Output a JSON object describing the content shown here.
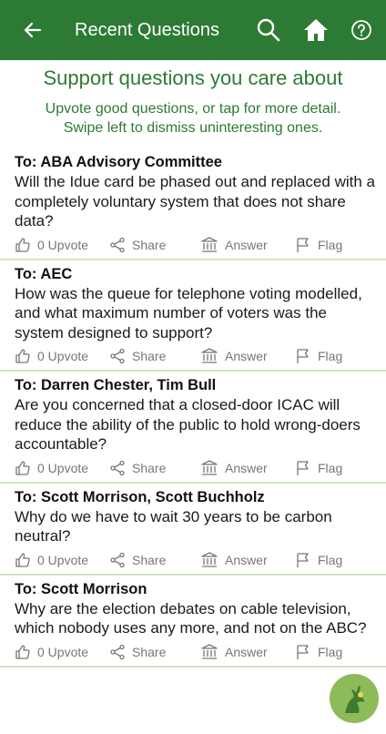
{
  "app_bar": {
    "title": "Recent Questions",
    "icons": [
      "back-arrow-icon",
      "search-icon",
      "home-icon",
      "help-icon"
    ]
  },
  "intro": {
    "heading": "Support questions you care about",
    "line1": "Upvote good questions, or tap for more detail.",
    "line2": "Swipe left to dismiss uninteresting ones."
  },
  "questions": [
    {
      "to": "To: ABA Advisory Committee",
      "text": "Will the Idue card be phased out and replaced with a completely voluntary system that does not share data?",
      "upvote": "0 Upvote",
      "share": "Share",
      "answer": "Answer",
      "flag": "Flag"
    },
    {
      "to": "To: AEC",
      "text": "How was the queue for telephone voting modelled, and what maximum number of voters was the system designed to support?",
      "upvote": "0 Upvote",
      "share": "Share",
      "answer": "Answer",
      "flag": "Flag"
    },
    {
      "to": "To: Darren Chester, Tim Bull",
      "text": "Are you concerned that a closed-door ICAC will reduce the ability of the public to hold wrong-doers accountable?",
      "upvote": "0 Upvote",
      "share": "Share",
      "answer": "Answer",
      "flag": "Flag"
    },
    {
      "to": "To: Scott Morrison, Scott Buchholz",
      "text": "Why do we have to wait 30 years to be carbon neutral?",
      "upvote": "0 Upvote",
      "share": "Share",
      "answer": "Answer",
      "flag": "Flag"
    },
    {
      "to": "To: Scott Morrison",
      "text": "Why are the election debates on cable television, which nobody uses any more, and not on the ABC?",
      "upvote": "0 Upvote",
      "share": "Share",
      "answer": "Answer",
      "flag": "Flag"
    }
  ],
  "colors": {
    "primary": "#2d7a34",
    "divider": "#cfe4c8",
    "action_gray": "#777777",
    "fab": "#8dbb5a"
  }
}
